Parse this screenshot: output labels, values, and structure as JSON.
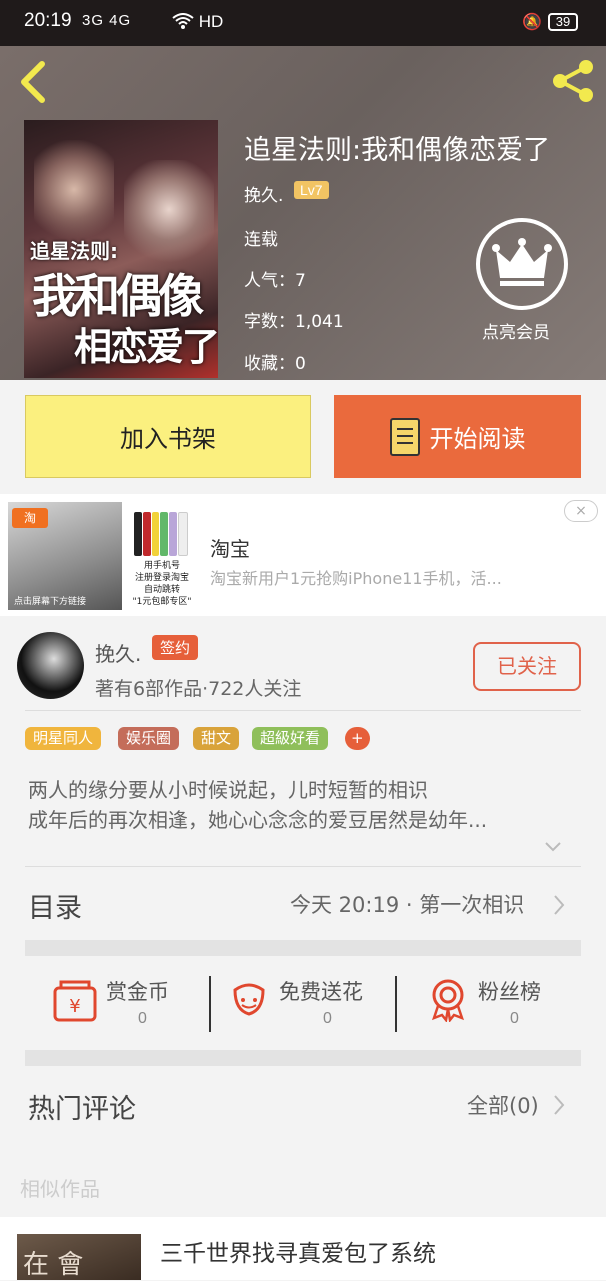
{
  "status_bar": {
    "time": "20:19",
    "network": "3G 4G",
    "wifi_label": "HD",
    "battery": "39"
  },
  "book": {
    "title": "追星法则:我和偶像恋爱了",
    "author": "挽久.",
    "level": "Lv7",
    "status": "连载",
    "popularity": "人气：7",
    "word_count": "字数：1,041",
    "favorites": "收藏：0",
    "cover_text_small": "追星法则:",
    "cover_text_big1": "我和偶像",
    "cover_text_big2": "相恋爱了"
  },
  "vip": {
    "label": "点亮会员"
  },
  "actions": {
    "add_shelf": "加入书架",
    "start_read": "开始阅读"
  },
  "ad": {
    "title": "淘宝",
    "desc": "淘宝新用户1元抢购iPhone11手机，活...",
    "tag": "淘",
    "image_caption": "点击屏幕下方链接",
    "image2_text": "用手机号\n注册登录淘宝\n自动跳转\n\"1元包邮专区\"",
    "close_icon": "×"
  },
  "author_card": {
    "name": "挽久.",
    "badge": "签约",
    "stats": "著有6部作品·722人关注",
    "follow_label": "已关注"
  },
  "tags": [
    {
      "label": "明星同人",
      "color": "#f0b53d"
    },
    {
      "label": "娱乐圈",
      "color": "#c46d5a"
    },
    {
      "label": "甜文",
      "color": "#d9a33a"
    },
    {
      "label": "超級好看",
      "color": "#8fbf5a"
    },
    {
      "label": "+",
      "color": "#e65f3a"
    }
  ],
  "intro": {
    "line1": "两人的缘分要从小时候说起，儿时短暂的相识",
    "line2": "成年后的再次相逢，她心心念念的爱豆居然是幼年..."
  },
  "toc": {
    "label": "目录",
    "latest": "今天 20:19 · 第一次相识"
  },
  "rewards": [
    {
      "label": "赏金币",
      "count": "0",
      "icon": "coin-envelope-icon"
    },
    {
      "label": "免费送花",
      "count": "0",
      "icon": "flower-icon"
    },
    {
      "label": "粉丝榜",
      "count": "0",
      "icon": "medal-icon"
    }
  ],
  "comments": {
    "label": "热门评论",
    "all": "全部(0)"
  },
  "similar": {
    "label": "相似作品",
    "first_title": "三千世界找寻真爱包了系统",
    "first_cover_text": "在 會"
  },
  "colors": {
    "accent": "#ea6a3d",
    "shelf": "#fbf07f",
    "share": "#f2e94e",
    "level": "#f2c463"
  }
}
